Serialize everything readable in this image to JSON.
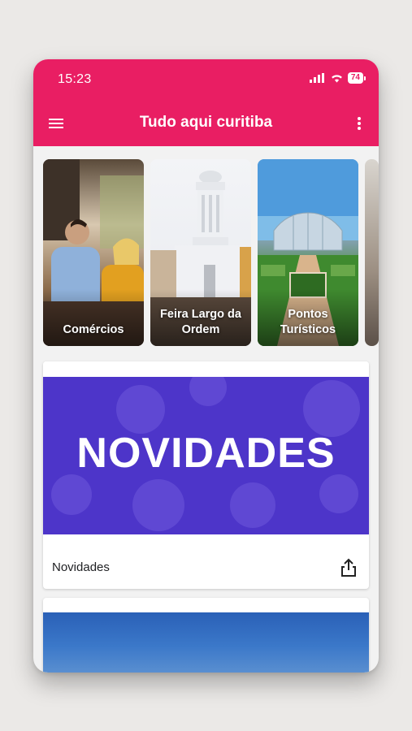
{
  "status_bar": {
    "time": "15:23",
    "battery": "74"
  },
  "app_bar": {
    "title": "Tudo aqui curitiba"
  },
  "categories": [
    {
      "label": "Comércios"
    },
    {
      "label": "Feira Largo da Ordem"
    },
    {
      "label": "Pontos Turísticos"
    }
  ],
  "cards": [
    {
      "banner_text": "NOVIDADES",
      "title": "Novidades"
    }
  ],
  "colors": {
    "accent": "#e91e63",
    "banner": "#4d35c9"
  },
  "icons": [
    "menu-icon",
    "more-vert-icon",
    "share-icon",
    "signal-icon",
    "wifi-icon",
    "battery-icon"
  ]
}
